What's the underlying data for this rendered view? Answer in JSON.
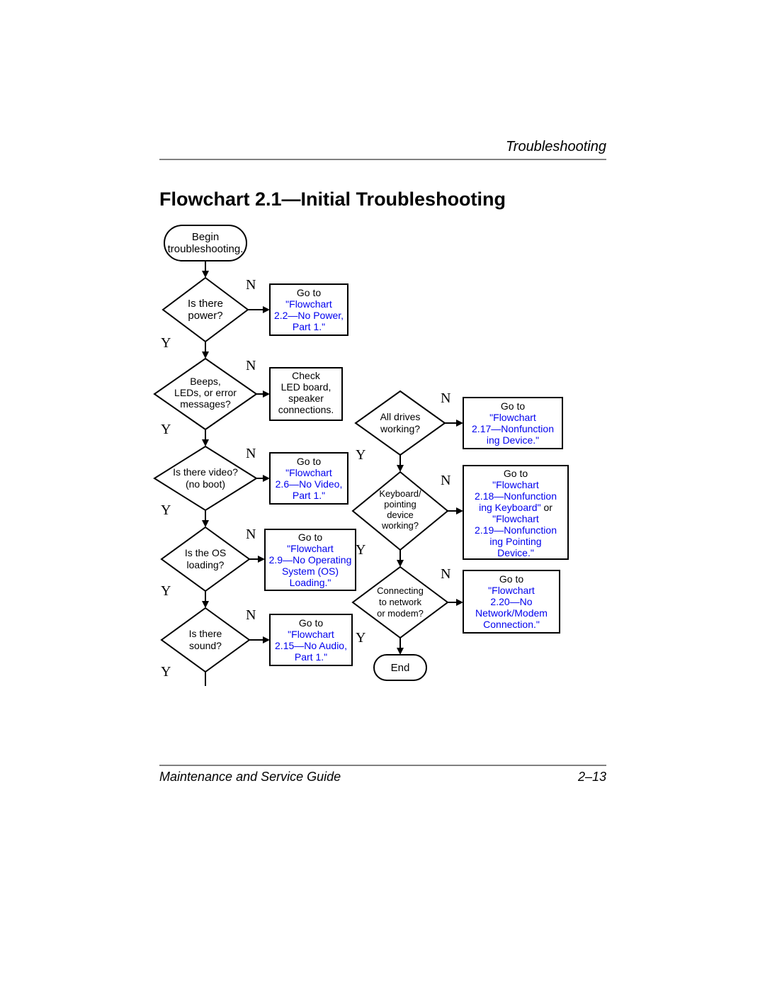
{
  "header": {
    "section": "Troubleshooting"
  },
  "title": "Flowchart 2.1—Initial Troubleshooting",
  "footer": {
    "left": "Maintenance and Service Guide",
    "right": "2–13"
  },
  "labels": {
    "yes": "Y",
    "no": "N"
  },
  "nodes": {
    "begin": {
      "line1": "Begin",
      "line2": "troubleshooting."
    },
    "power": {
      "line1": "Is there",
      "line2": "power?"
    },
    "beeps": {
      "line1": "Beeps,",
      "line2": "LEDs, or error",
      "line3": "messages?"
    },
    "video": {
      "line1": "Is there video?",
      "line2": "(no boot)"
    },
    "os": {
      "line1": "Is the OS",
      "line2": "loading?"
    },
    "sound": {
      "line1": "Is there",
      "line2": "sound?"
    },
    "drives": {
      "line1": "All drives",
      "line2": "working?"
    },
    "kbd": {
      "line1": "Keyboard/",
      "line2": "pointing",
      "line3": "device",
      "line4": "working?"
    },
    "net": {
      "line1": "Connecting",
      "line2": "to network",
      "line3": "or modem?"
    },
    "end": {
      "line1": "End"
    }
  },
  "boxes": {
    "power": {
      "pre": "Go to",
      "l1": "\"Flowchart",
      "l2": "2.2—No Power,",
      "l3": "Part 1.\""
    },
    "beeps": {
      "l1": "Check",
      "l2": "LED board,",
      "l3": "speaker",
      "l4": "connections."
    },
    "video": {
      "pre": "Go to",
      "l1": "\"Flowchart",
      "l2": "2.6—No Video,",
      "l3": "Part 1.\""
    },
    "os": {
      "pre": "Go to",
      "l1": "\"Flowchart",
      "l2": "2.9—No Operating",
      "l3": "System (OS)",
      "l4": "Loading.\""
    },
    "sound": {
      "pre": "Go to",
      "l1": "\"Flowchart",
      "l2": "2.15—No Audio,",
      "l3": "Part 1.\""
    },
    "drives": {
      "pre": "Go to",
      "l1": "\"Flowchart",
      "l2": "2.17—Nonfunction",
      "l3": "ing Device.\""
    },
    "kbd": {
      "pre": "Go to",
      "l1": "\"Flowchart",
      "l2": "2.18—Nonfunction",
      "l3": "ing Keyboard\"",
      "post": " or",
      "l4": "\"Flowchart",
      "l5": "2.19—Nonfunction",
      "l6": "ing Pointing",
      "l7": "Device.\""
    },
    "net": {
      "pre": "Go to",
      "l1": "\"Flowchart",
      "l2": "2.20—No",
      "l3": "Network/Modem",
      "l4": "Connection.\""
    }
  }
}
